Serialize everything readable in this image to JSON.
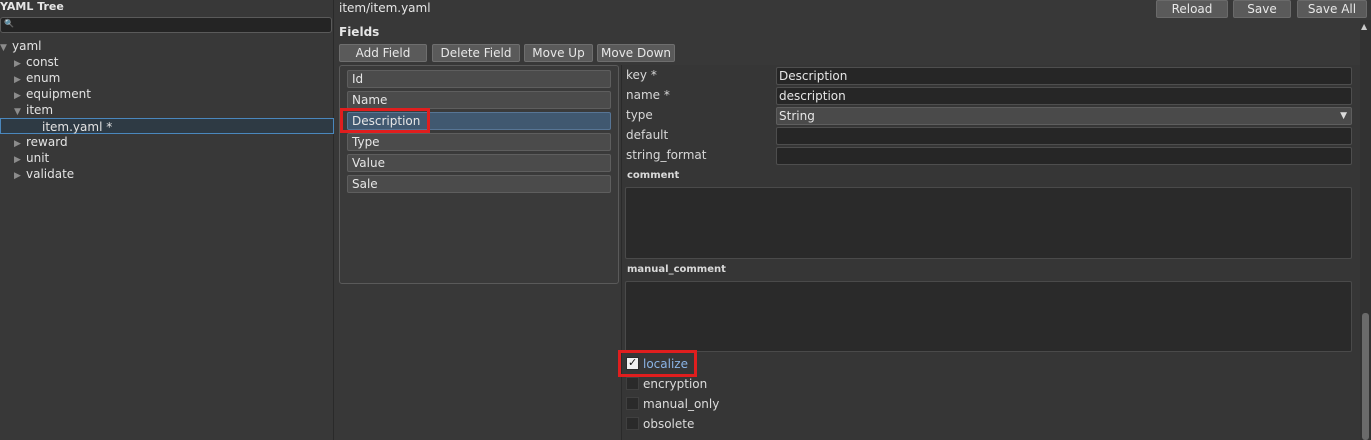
{
  "tree": {
    "title": "YAML Tree",
    "search_icon": "search-icon",
    "nodes": [
      {
        "label": "yaml",
        "expanded": true
      },
      {
        "label": "const",
        "expanded": false
      },
      {
        "label": "enum",
        "expanded": false
      },
      {
        "label": "equipment",
        "expanded": false
      },
      {
        "label": "item",
        "expanded": true
      },
      {
        "label": "item.yaml *",
        "selected": true
      },
      {
        "label": "reward",
        "expanded": false
      },
      {
        "label": "unit",
        "expanded": false
      },
      {
        "label": "validate",
        "expanded": false
      }
    ]
  },
  "header": {
    "file_title": "item/item.yaml",
    "reload_label": "Reload",
    "save_label": "Save",
    "save_all_label": "Save All"
  },
  "fields": {
    "title": "Fields",
    "toolbar": {
      "add": "Add Field",
      "delete": "Delete Field",
      "up": "Move Up",
      "down": "Move Down"
    },
    "items": [
      "Id",
      "Name",
      "Description",
      "Type",
      "Value",
      "Sale"
    ],
    "selected": "Description"
  },
  "props": {
    "key_label": "key *",
    "key_value": "Description",
    "name_label": "name *",
    "name_value": "description",
    "type_label": "type",
    "type_value": "String",
    "default_label": "default",
    "default_value": "",
    "string_format_label": "string_format",
    "string_format_value": "",
    "comment_label": "comment",
    "manual_comment_label": "manual_comment",
    "checkboxes": [
      {
        "label": "localize",
        "checked": true
      },
      {
        "label": "encryption",
        "checked": false
      },
      {
        "label": "manual_only",
        "checked": false
      },
      {
        "label": "obsolete",
        "checked": false
      }
    ]
  },
  "colors": {
    "background": "#383838",
    "selection": "#405870",
    "highlight": "#e01e1e",
    "checked_label": "#8ab4e6"
  }
}
